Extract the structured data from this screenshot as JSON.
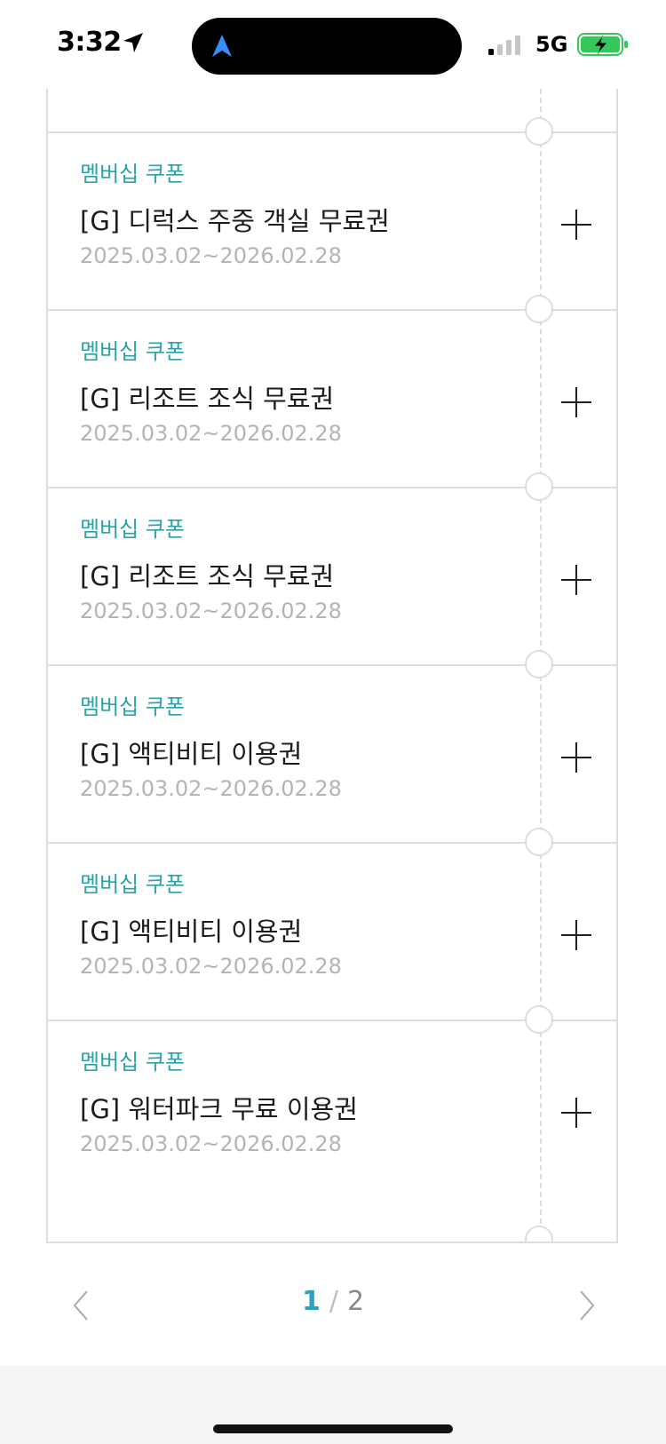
{
  "status_bar": {
    "time": "3:32",
    "network": "5G"
  },
  "colors": {
    "accent": "#2aa3a8",
    "page_current": "#2aa3c0",
    "battery_fill": "#34c759"
  },
  "coupons": [
    {
      "type": "멤버십 쿠폰",
      "title": "[G] 디럭스 주중 객실 무료권",
      "period": "2025.03.02~2026.02.28"
    },
    {
      "type": "멤버십 쿠폰",
      "title": "[G] 리조트 조식 무료권",
      "period": "2025.03.02~2026.02.28"
    },
    {
      "type": "멤버십 쿠폰",
      "title": "[G] 리조트 조식 무료권",
      "period": "2025.03.02~2026.02.28"
    },
    {
      "type": "멤버십 쿠폰",
      "title": "[G] 액티비티 이용권",
      "period": "2025.03.02~2026.02.28"
    },
    {
      "type": "멤버십 쿠폰",
      "title": "[G] 액티비티 이용권",
      "period": "2025.03.02~2026.02.28"
    },
    {
      "type": "멤버십 쿠폰",
      "title": "[G] 워터파크 무료 이용권",
      "period": "2025.03.02~2026.02.28"
    }
  ],
  "pagination": {
    "current": "1",
    "separator": "/",
    "total": "2"
  },
  "icons": {
    "add": "plus-icon",
    "prev": "chevron-left-icon",
    "next": "chevron-right-icon"
  }
}
